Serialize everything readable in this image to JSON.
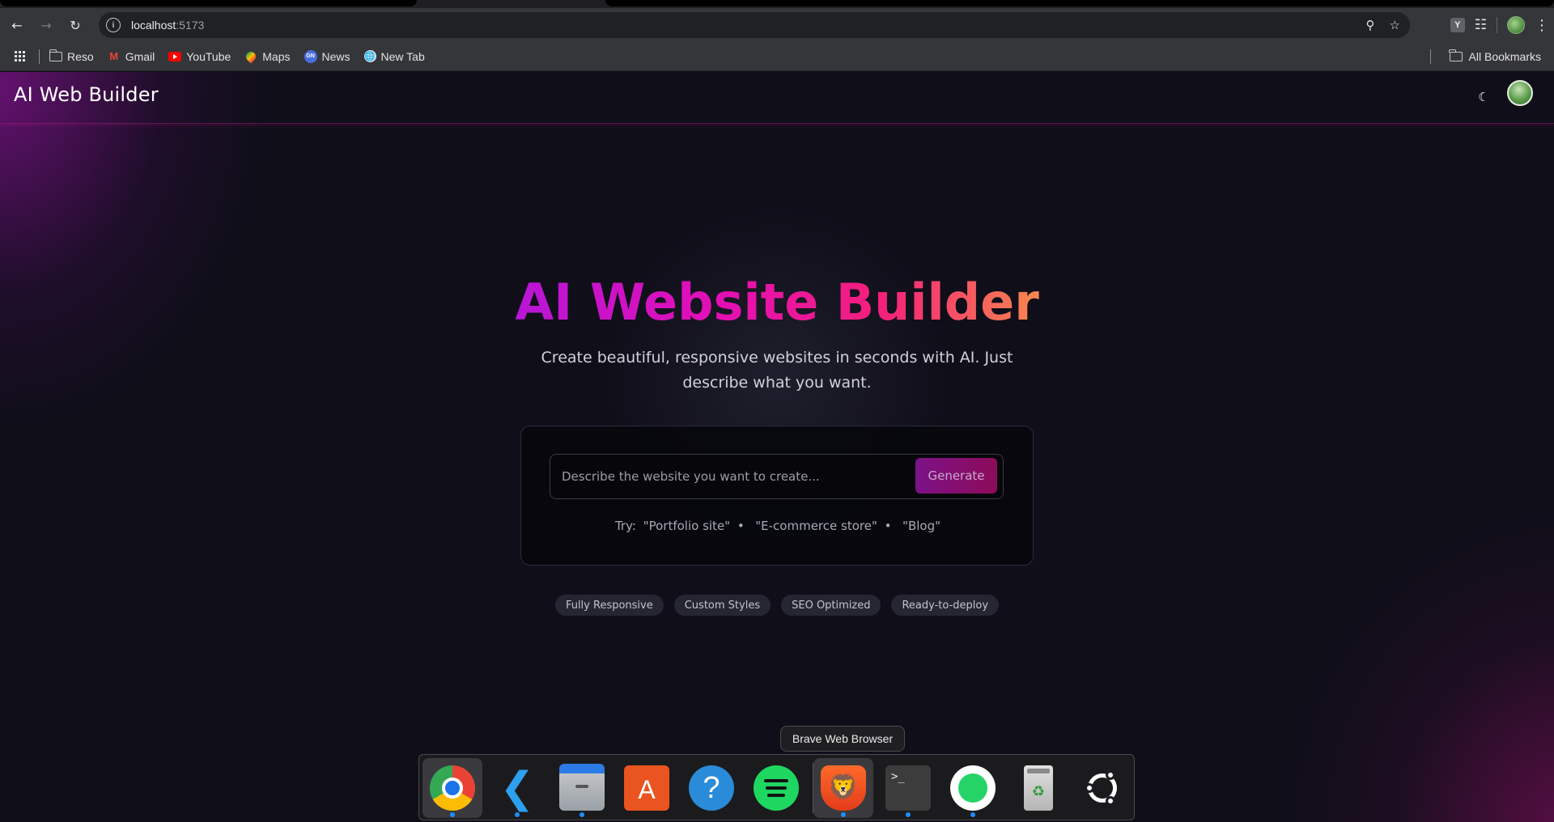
{
  "browser": {
    "url_host": "localhost",
    "url_port": ":5173",
    "bookmarks": [
      {
        "label": "Reso",
        "icon": "folder-icon"
      },
      {
        "label": "Gmail",
        "icon": "gmail-icon"
      },
      {
        "label": "YouTube",
        "icon": "youtube-icon"
      },
      {
        "label": "Maps",
        "icon": "maps-icon"
      },
      {
        "label": "News",
        "icon": "news-icon"
      },
      {
        "label": "New Tab",
        "icon": "globe-icon"
      }
    ],
    "all_bookmarks": "All Bookmarks",
    "extension_letter": "Y"
  },
  "app": {
    "brand": "AI Web Builder",
    "hero_title": "AI Website Builder",
    "hero_subtitle": "Create beautiful, responsive websites in seconds with AI. Just describe what you want.",
    "prompt_placeholder": "Describe the website you want to create...",
    "prompt_value": "",
    "generate_label": "Generate",
    "try_prefix": "Try: ",
    "suggestions": [
      "\"Portfolio site\"",
      "\"E-commerce store\"",
      "\"Blog\""
    ],
    "separator": "•",
    "features": [
      "Fully Responsive",
      "Custom Styles",
      "SEO Optimized",
      "Ready-to-deploy"
    ],
    "accent_gradient": [
      "#b716d6",
      "#e40fb4",
      "#f4207a",
      "#f7874d"
    ]
  },
  "dock": {
    "tooltip": "Brave Web Browser",
    "items": [
      {
        "name": "Google Chrome",
        "icon": "chrome-icon",
        "running": true
      },
      {
        "name": "Visual Studio Code",
        "icon": "vscode-icon",
        "running": true
      },
      {
        "name": "Files",
        "icon": "files-icon",
        "running": true
      },
      {
        "name": "App Center",
        "icon": "app-store-icon",
        "running": false
      },
      {
        "name": "Help",
        "icon": "help-icon",
        "running": false
      },
      {
        "name": "Spotify",
        "icon": "spotify-icon",
        "running": false
      },
      {
        "name": "Brave Web Browser",
        "icon": "brave-icon",
        "running": true
      },
      {
        "name": "Terminal",
        "icon": "terminal-icon",
        "running": true
      },
      {
        "name": "WhatsApp",
        "icon": "whatsapp-icon",
        "running": true
      },
      {
        "name": "Trash",
        "icon": "trash-icon",
        "running": false
      },
      {
        "name": "Show Apps",
        "icon": "ubuntu-icon",
        "running": false
      }
    ],
    "terminal_glyph": ">_",
    "help_glyph": "?",
    "store_glyph": "A"
  }
}
